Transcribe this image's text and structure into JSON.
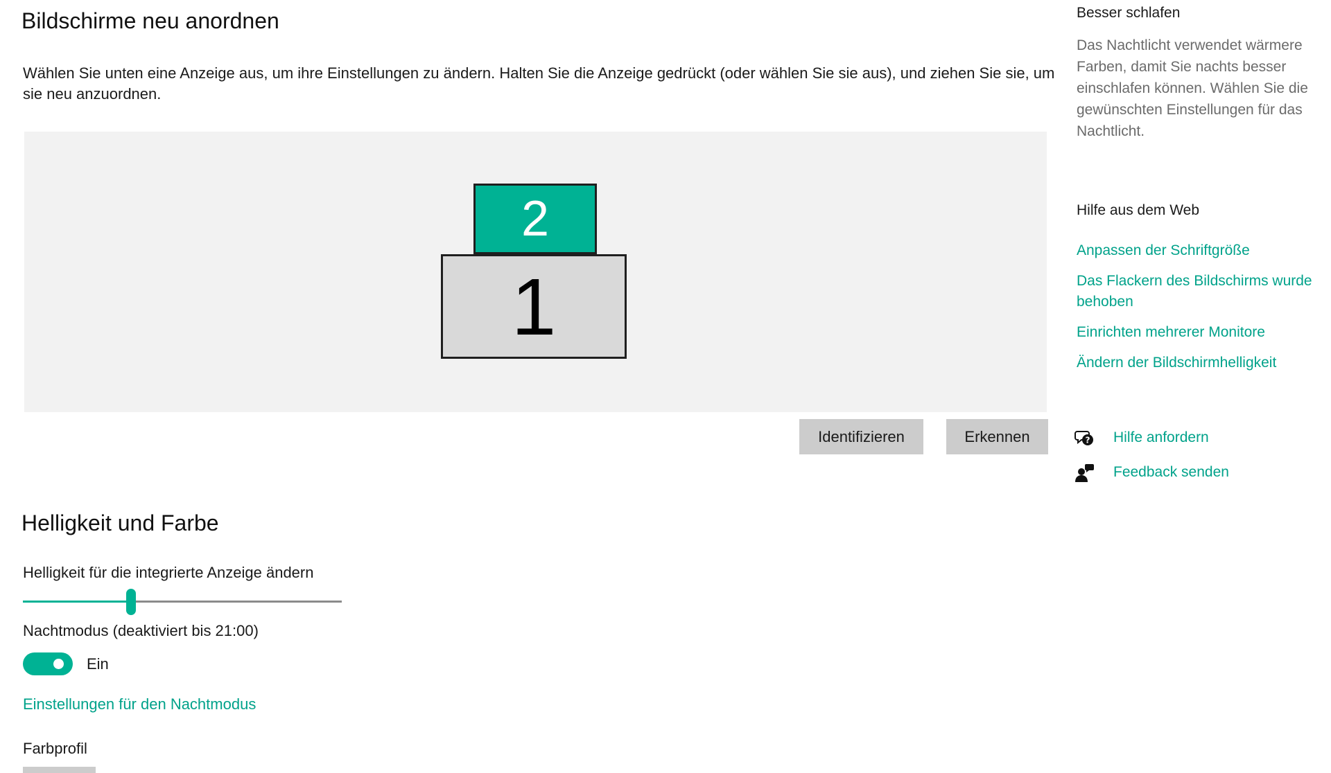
{
  "arrange": {
    "title": "Bildschirme neu anordnen",
    "instructions": "Wählen Sie unten eine Anzeige aus, um ihre Einstellungen zu ändern. Halten Sie die Anzeige gedrückt (oder wählen Sie sie aus), und ziehen Sie sie, um sie neu anzuordnen.",
    "monitors": [
      {
        "label": "2",
        "selected": true
      },
      {
        "label": "1",
        "selected": false
      }
    ],
    "identify_label": "Identifizieren",
    "detect_label": "Erkennen"
  },
  "brightness": {
    "title": "Helligkeit und Farbe",
    "label": "Helligkeit für die integrierte Anzeige ändern",
    "value": 34,
    "max": 100,
    "nightmode_label": "Nachtmodus (deaktiviert bis 21:00)",
    "nightmode_on": true,
    "nightmode_state": "Ein",
    "nightmode_settings_link": "Einstellungen für den Nachtmodus",
    "color_profile_label": "Farbprofil"
  },
  "sidebar": {
    "sleep_title": "Besser schlafen",
    "sleep_text": "Das Nachtlicht verwendet wärmere Farben, damit Sie nachts besser einschlafen können. Wählen Sie die gewünschten Einstellungen für das Nachtlicht.",
    "web_help_title": "Hilfe aus dem Web",
    "help_links": [
      "Anpassen der Schriftgröße",
      "Das Flackern des Bildschirms wurde behoben",
      "Einrichten mehrerer Monitore",
      "Ändern der Bildschirmhelligkeit"
    ],
    "get_help": "Hilfe anfordern",
    "feedback": "Feedback senden"
  },
  "colors": {
    "accent": "#00b294",
    "link": "#00a28a",
    "button_bg": "#cccccc",
    "canvas_bg": "#f2f2f2"
  },
  "icons": {
    "get_help": "chat-question-icon",
    "feedback": "person-feedback-icon"
  }
}
